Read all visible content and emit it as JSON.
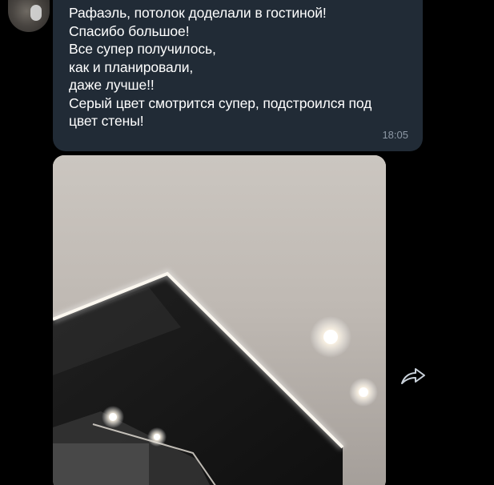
{
  "message": {
    "lines": [
      "Рафаэль, потолок доделали в гостиной!",
      "Спасибо большое!",
      "Все супер получилось,",
      "как и планировали,",
      "даже лучше!!",
      "Серый цвет смотрится супер, подстроился под",
      "цвет стены!"
    ],
    "time": "18:05"
  },
  "icons": {
    "share": "share-forward-icon",
    "avatar": "avatar"
  },
  "colors": {
    "background": "#000000",
    "bubble": "#212b36",
    "text": "#ffffff",
    "time": "#8d98a5",
    "share_icon": "#c9d1da"
  }
}
